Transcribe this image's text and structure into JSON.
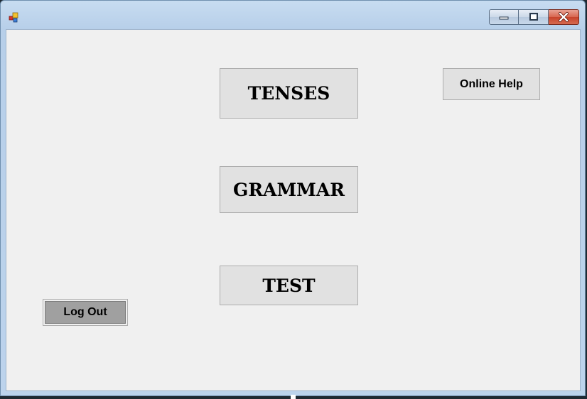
{
  "window": {
    "title": "",
    "icon": "app-window-icon",
    "controls": {
      "minimize_icon": "minimize-icon",
      "maximize_icon": "maximize-icon",
      "close_icon": "close-icon"
    }
  },
  "buttons": {
    "tenses": "TENSES",
    "grammar": "GRAMMAR",
    "test": "TEST",
    "online_help": "Online Help",
    "log_out": "Log Out"
  },
  "colors": {
    "client_background": "#f0f0f0",
    "button_face": "#e1e1e1",
    "logout_face": "#a0a0a0",
    "close_button": "#c7432b"
  }
}
